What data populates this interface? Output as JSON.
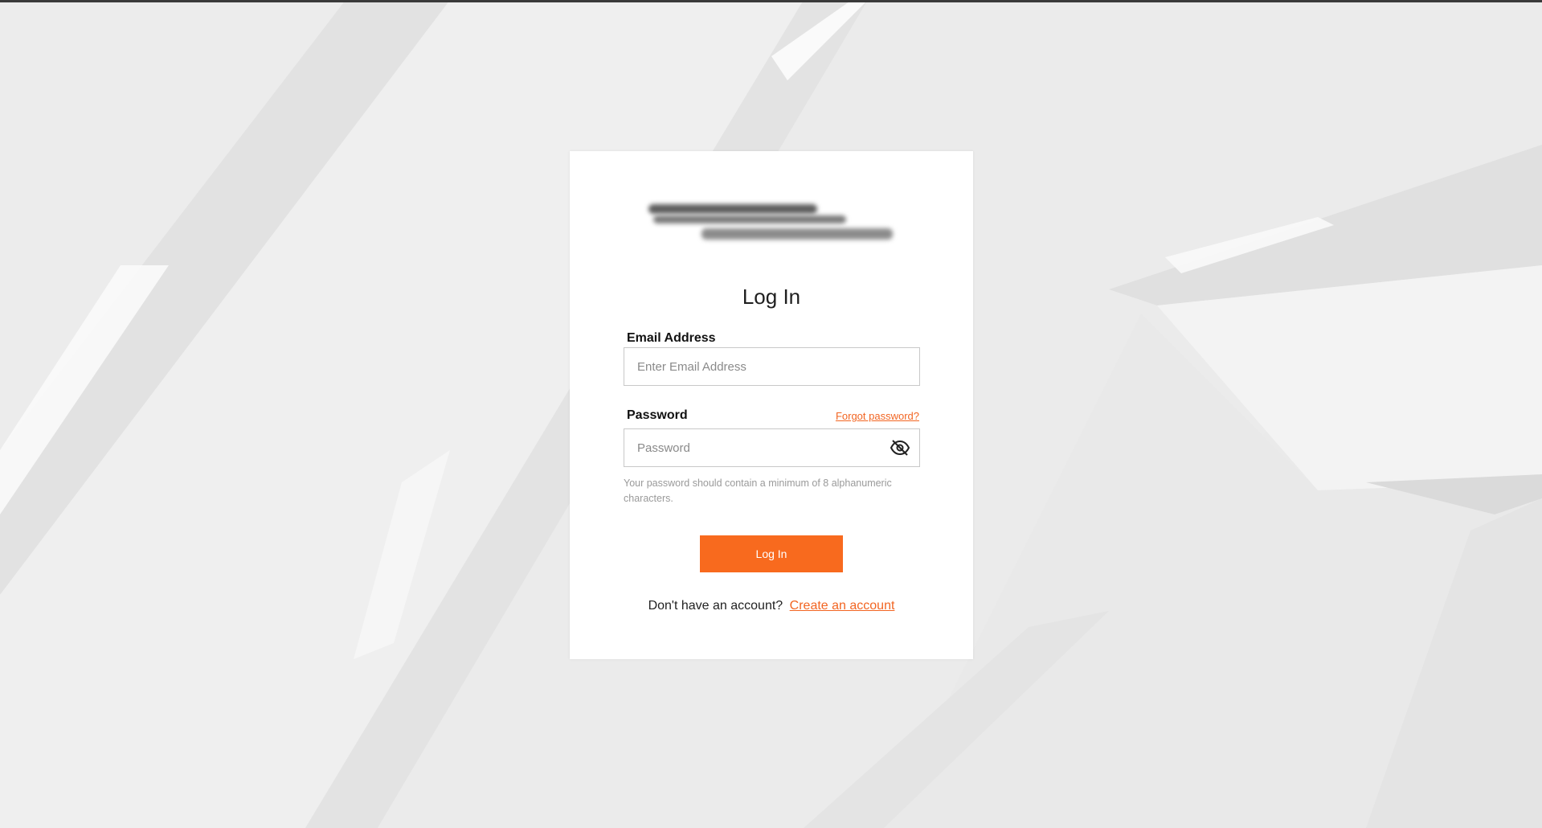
{
  "login": {
    "title": "Log In",
    "email": {
      "label": "Email Address",
      "placeholder": "Enter Email Address",
      "value": ""
    },
    "password": {
      "label": "Password",
      "placeholder": "Password",
      "value": "",
      "forgot_label": "Forgot password?",
      "toggle_icon": "eye-off-icon",
      "hint": "Your password should contain a minimum of 8 alphanumeric characters."
    },
    "submit_label": "Log In",
    "signup_prompt": "Don't have an account?",
    "signup_link": "Create an account"
  },
  "colors": {
    "accent": "#f86a1e",
    "link": "#f26522",
    "background": "#ededed",
    "card": "#ffffff"
  }
}
